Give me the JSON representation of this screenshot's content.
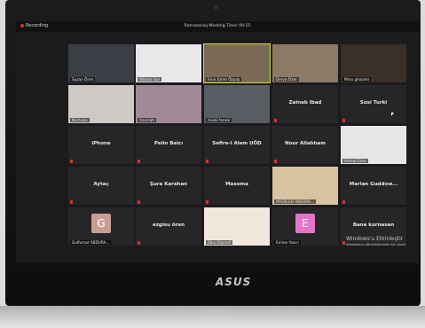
{
  "top_bar": {
    "recording_label": "Recording",
    "meeting_title": "Ramazanlıq Meeting Timer 09:15"
  },
  "participants": [
    {
      "name": "Suzan Ören",
      "label": "",
      "type": "video",
      "tone": "#3b3e44"
    },
    {
      "name": "Wildan Gul",
      "label": "",
      "type": "video",
      "tone": "#e9e7ea"
    },
    {
      "name": "Emir Emre Özpaş",
      "label": "",
      "type": "video",
      "tone": "#7a6a54",
      "active": true
    },
    {
      "name": "Derya Özer",
      "label": "",
      "type": "video",
      "tone": "#8c7a66"
    },
    {
      "name": "Mina gholami",
      "label": "",
      "type": "video",
      "tone": "#3a3028"
    },
    {
      "name": "Nurhaka",
      "label": "",
      "type": "video",
      "tone": "#cfc9c6"
    },
    {
      "name": "Asumah",
      "label": "",
      "type": "video",
      "tone": "#a08a98"
    },
    {
      "name": "mükü tanok",
      "label": "",
      "type": "video",
      "tone": "#5a5c64"
    },
    {
      "name": "",
      "label": "Zainab Ibad",
      "type": "text"
    },
    {
      "name": "",
      "label": "Susi Turki",
      "type": "text"
    },
    {
      "name": "",
      "label": "iPhone",
      "type": "text"
    },
    {
      "name": "",
      "label": "Pelin Balcı",
      "type": "text"
    },
    {
      "name": "",
      "label": "Sefire-i Alem UÖD",
      "type": "text"
    },
    {
      "name": "",
      "label": "Nour Allahham",
      "type": "text"
    },
    {
      "name": "Ahmet Eren",
      "label": "",
      "type": "photo",
      "tone": "#e6e6e6"
    },
    {
      "name": "",
      "label": "Aytaç",
      "type": "text"
    },
    {
      "name": "",
      "label": "Şura Karahan",
      "type": "text"
    },
    {
      "name": "",
      "label": "Masoma",
      "type": "text"
    },
    {
      "name": "AYGÜLGÜ ABDURA...",
      "label": "",
      "type": "photo",
      "tone": "#d8c3a0"
    },
    {
      "name": "",
      "label": "Marian Guddow...",
      "type": "text"
    },
    {
      "name": "Gulfumar ABDURA...",
      "label": "",
      "type": "avatar",
      "letter": "G",
      "avatar_class": "g"
    },
    {
      "name": "",
      "label": "ezgisu ören",
      "type": "text"
    },
    {
      "name": "Ebru Elşenef",
      "label": "",
      "type": "photo",
      "tone": "#f1e7dc"
    },
    {
      "name": "Emine Yazıcı",
      "label": "",
      "type": "avatar",
      "letter": "E",
      "avatar_class": "e"
    },
    {
      "name": "",
      "label": "Bana kurnasan",
      "type": "text"
    }
  ],
  "watermark": {
    "line1": "Windows'u Etkinleştir",
    "line2": "Windows'u etkinleştirmek için Ayarl"
  },
  "laptop": {
    "brand": "ASUS",
    "lower_text": "LOLO"
  }
}
